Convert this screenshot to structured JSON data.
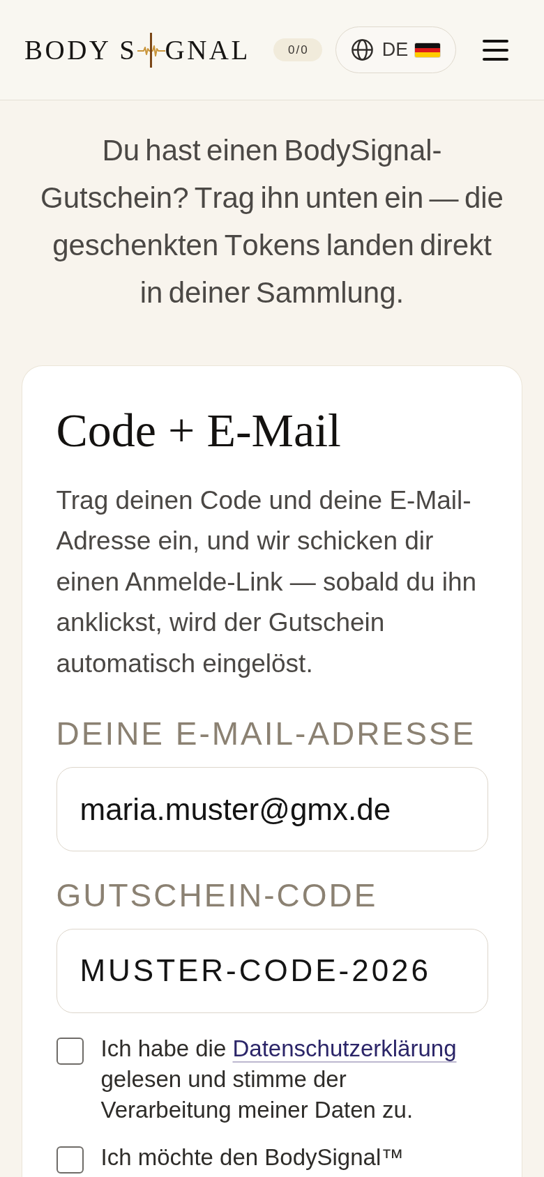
{
  "header": {
    "logo": {
      "text_left": "BODY S",
      "text_right": "GNAL"
    },
    "counter": "0/0",
    "language": "DE"
  },
  "intro": "Du hast einen BodySignal-Gutschein? Trag ihn unten ein — die geschenkten Tokens landen direkt in deiner Sammlung.",
  "card": {
    "title": "Code + E-Mail",
    "description": "Trag deinen Code und deine E-Mail-Adresse ein, und wir schicken dir einen Anmelde-Link — sobald du ihn anklickst, wird der Gutschein automatisch eingelöst.",
    "fields": [
      {
        "kind": "email",
        "label": "DEINE E-MAIL-ADRESSE",
        "value": "maria.muster@gmx.de"
      },
      {
        "kind": "code",
        "label": "GUTSCHEIN-CODE",
        "value": "MUSTER-CODE-2026"
      }
    ],
    "consents": [
      {
        "checked": false,
        "parts": [
          {
            "kind": "text",
            "text": "Ich habe die"
          },
          {
            "kind": "link",
            "text": "Datenschutzerklärung"
          },
          {
            "kind": "text",
            "text": "gelesen und stimme der Verarbeitung meiner Daten zu."
          }
        ]
      },
      {
        "checked": false,
        "parts": [
          {
            "kind": "text",
            "text": "Ich möchte den BodySignal™"
          }
        ]
      }
    ]
  }
}
